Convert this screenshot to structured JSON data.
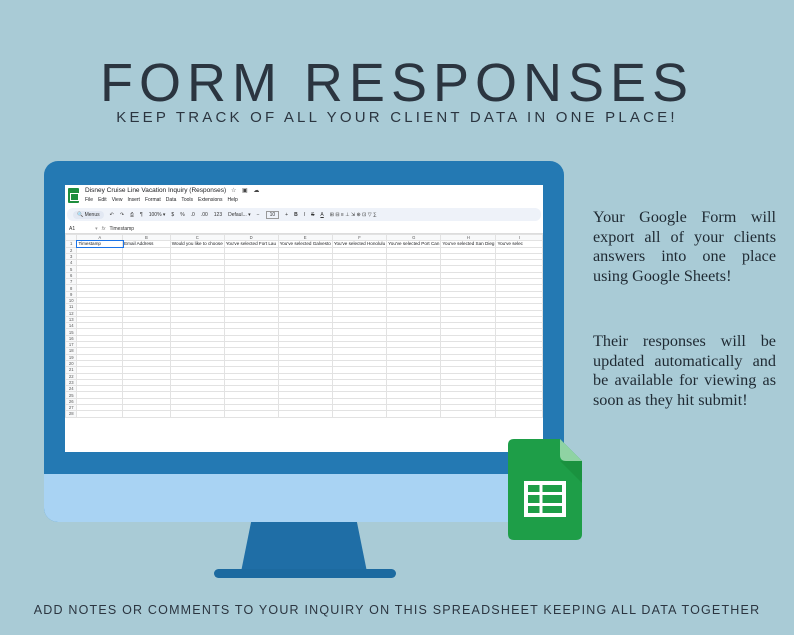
{
  "header": {
    "title": "FORM RESPONSES",
    "subtitle": "KEEP TRACK OF ALL YOUR CLIENT DATA IN ONE PLACE!"
  },
  "footer": "ADD NOTES OR COMMENTS TO YOUR INQUIRY ON THIS SPREADSHEET KEEPING ALL DATA TOGETHER",
  "description": {
    "paragraph_1": "Your Google Form will export all of your clients answers into one place using Google Sheets!",
    "paragraph_2": "Their responses will be updated automatically and be available for viewing as soon as they hit submit!"
  },
  "sheet": {
    "doc_title": "Disney Cruise Line Vacation Inquiry (Responses)",
    "doc_icons": "☆ ▣ ☁",
    "menu": [
      "File",
      "Edit",
      "View",
      "Insert",
      "Format",
      "Data",
      "Tools",
      "Extensions",
      "Help"
    ],
    "toolbar": {
      "menus": "🔍 Menus",
      "undo": "↶",
      "redo": "↷",
      "print": "⎙",
      "paint": "¶",
      "zoom": "100% ▾",
      "currency": "$",
      "percent": "%",
      "dec_less": ".0",
      "dec_more": ".00",
      "format_123": "123",
      "font": "Defaul... ▾",
      "minus": "−",
      "font_size": "10",
      "plus": "+",
      "bold": "B",
      "italic": "I",
      "strike": "S",
      "text_color": "A",
      "more": "⊞ ⊟ ≡ ⊥ ⇲ ⊕ ⊡ ▽ ∑"
    },
    "cell_ref": "A1",
    "fx": "fx",
    "formula_value": "Timestamp",
    "columns": [
      "A",
      "B",
      "C",
      "D",
      "E",
      "F",
      "G",
      "H",
      "I"
    ],
    "header_row": [
      "Timestamp",
      "Email Address",
      "Would you like to choose",
      "You've selected Fort Lau",
      "You've selected Galvesto",
      "You've selected Honolulu",
      "You've selected Port Can",
      "You've selected San Dieg",
      "You've selec"
    ],
    "row_numbers": [
      "1",
      "2",
      "3",
      "4",
      "5",
      "6",
      "7",
      "8",
      "9",
      "10",
      "11",
      "12",
      "13",
      "14",
      "15",
      "16",
      "17",
      "18",
      "19",
      "20",
      "21",
      "22",
      "23",
      "24",
      "25",
      "26",
      "27",
      "28"
    ]
  },
  "colors": {
    "background": "#a9cbd6",
    "monitor": "#2479b3",
    "monitor_chin": "#a9d3f3",
    "sheets_green": "#1e8e3e"
  }
}
